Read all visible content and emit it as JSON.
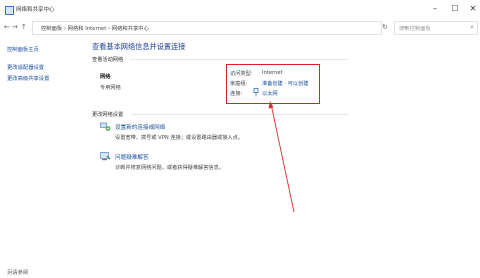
{
  "window": {
    "title": "网络和共享中心",
    "minimize": "–",
    "maximize": "☐",
    "close": "✕"
  },
  "nav": {
    "back": "←",
    "forward": "→",
    "up": "↑",
    "breadcrumb": "控制面板  ›  网络和 Internet  ›  网络和共享中心",
    "dropdown": "⌄",
    "refresh": "↻",
    "search_placeholder": "搜索控制面板",
    "search_icon": "⌕"
  },
  "sidebar": {
    "items": [
      {
        "label": "控制面板主页"
      },
      {
        "label": "更改适配器设置"
      },
      {
        "label": "更改高级共享设置"
      }
    ],
    "see_also": "另请参阅"
  },
  "main": {
    "title": "查看基本网络信息并设置连接",
    "active_networks_label": "查看活动网络",
    "network": {
      "name": "网络",
      "type": "专用网络",
      "access_type_label": "访问类型:",
      "access_type_value": "Internet",
      "homegroup_label": "家庭组:",
      "homegroup_value": "准备创建 · 可以创建",
      "connection_label": "连接:",
      "connection_value": "以太网"
    },
    "change_settings_label": "更改网络设置",
    "tasks": [
      {
        "icon": "network-setup-icon",
        "link": "设置新的连接或网络",
        "desc": "设置宽带、拨号或 VPN 连接；或设置路由器或接入点。"
      },
      {
        "icon": "troubleshoot-icon",
        "link": "问题疑难解答",
        "desc": "诊断并修复网络问题，或者获得疑难解答信息。"
      }
    ]
  },
  "annotation": {
    "color": "#e02020"
  }
}
